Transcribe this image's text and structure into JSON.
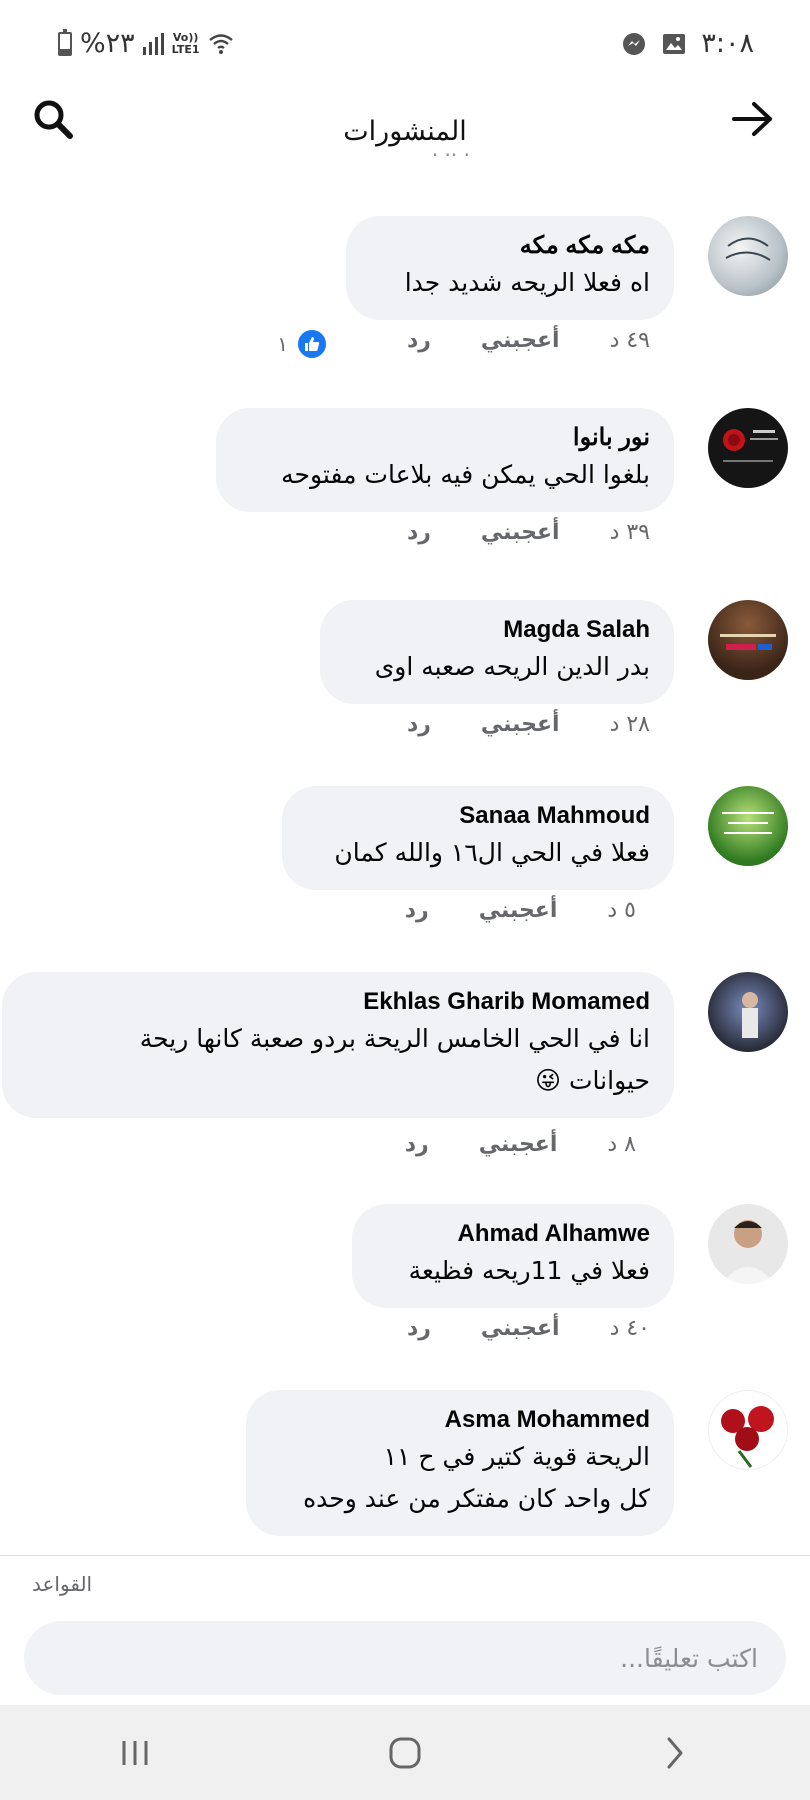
{
  "status_bar": {
    "time": "٣:٠٨",
    "battery_percent_text": "%٢٣",
    "network_label_top": "Vo))",
    "network_label_bottom": "LTE1",
    "battery_level": 0.23,
    "icons": [
      "messenger-icon",
      "gallery-icon",
      "battery-icon",
      "signal-icon",
      "wifi-icon"
    ]
  },
  "header": {
    "title": "المنشورات",
    "back_icon": "arrow-right-icon",
    "search_icon": "search-icon"
  },
  "actions": {
    "like_label": "أعجبني",
    "reply_label": "رد"
  },
  "comments": [
    {
      "author": "مكه مكه مكه",
      "lines": [
        "اه فعلا الريحه شديد جدا"
      ],
      "time": "٤٩ د",
      "reactions": {
        "type": "like",
        "count": "١"
      }
    },
    {
      "author": "نور بانوا",
      "lines": [
        "بلغوا الحي يمكن فيه بلاعات مفتوحه"
      ],
      "time": "٣٩ د"
    },
    {
      "author": "Magda Salah",
      "lines": [
        "بدر الدين الريحه صعبه اوى"
      ],
      "time": "٢٨ د"
    },
    {
      "author": "Sanaa Mahmoud",
      "lines": [
        "فعلا في الحي ال١٦  والله كمان"
      ],
      "time": "٥ د"
    },
    {
      "author": "Ekhlas Gharib Momamed",
      "lines": [
        "انا في الحي الخامس الريحة بردو صعبة كانها ريحة",
        "حيوانات 😜"
      ],
      "time": "٨ د"
    },
    {
      "author": "Ahmad Alhamwe",
      "lines": [
        "فعلا في 11ريحه فظيعة"
      ],
      "time": "٤٠ د"
    },
    {
      "author": "Asma Mohammed",
      "lines": [
        "الريحة قوية كتير في ح ١١",
        "كل واحد كان مفتكر من عند وحده"
      ],
      "time": ""
    }
  ],
  "composer": {
    "rules_label": "القواعد",
    "placeholder": "اكتب تعليقًا..."
  },
  "nav": {
    "recent_icon": "recent-apps-icon",
    "home_icon": "home-icon",
    "back_icon": "back-chevron-icon"
  }
}
